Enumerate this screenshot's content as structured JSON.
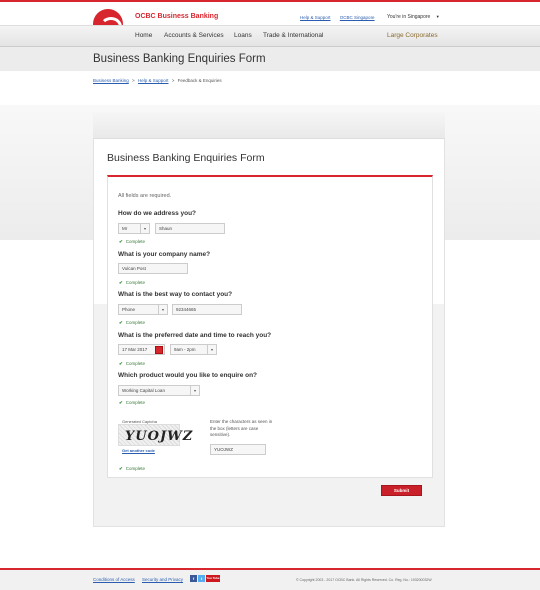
{
  "header": {
    "brand": "OCBC Business Banking",
    "links": [
      "Help & Support",
      "OCBC Singapore"
    ],
    "region": "You're in Singapore",
    "region_caret": "▼"
  },
  "nav": {
    "items": [
      "Home",
      "Accounts & Services",
      "Loans",
      "Trade & International"
    ],
    "right_item": "Large Corporates"
  },
  "page": {
    "title": "Business Banking Enquiries Form",
    "breadcrumb": [
      "Business Banking",
      "Help & Support",
      "Feedback & Enquiries"
    ],
    "breadcrumb_sep": ">"
  },
  "form": {
    "title": "Business Banking Enquiries Form",
    "required_note": "All fields are required.",
    "complete_label": "Complete",
    "q1": {
      "label": "How do we address you?",
      "salutation": "Mr",
      "name": "Shaun"
    },
    "q2": {
      "label": "What is your company name?",
      "value": "Vulcan Post"
    },
    "q3": {
      "label": "What is the best way to contact you?",
      "method": "Phone",
      "number": "92344665"
    },
    "q4": {
      "label": "What is the preferred date and time to reach you?",
      "date": "17 Mar 2017",
      "time": "9am - 2pm"
    },
    "q5": {
      "label": "Which product would you like to enquire on?",
      "product": "Working Capital Loan"
    },
    "captcha": {
      "label": "Generated Captcha",
      "image_text": "YUOJWZ",
      "new_link": "Get another code",
      "hint": "Enter the characters as seen in the box (letters are case sensitive).",
      "value": "YUOJWZ"
    },
    "submit": "Submit"
  },
  "footer": {
    "links": [
      "Conditions of Access",
      "Security and Privacy"
    ],
    "social": [
      "f",
      "t",
      "You Tube"
    ],
    "copyright": "© Copyright 2003 - 2017 OCBC Bank. All Rights Reserved. Co. Reg. No.: 193200032W"
  }
}
